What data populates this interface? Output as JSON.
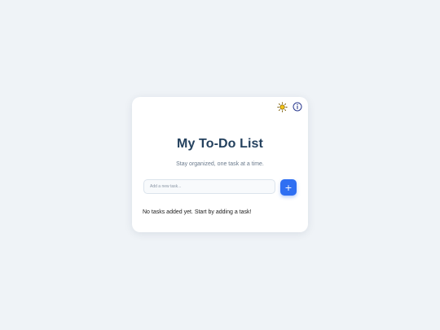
{
  "header": {
    "theme_toggle_icon": "sun-icon",
    "info_icon": "info-icon"
  },
  "main": {
    "title": "My To-Do List",
    "subtitle": "Stay organized, one task at a time.",
    "input_placeholder": "Add a new task...",
    "input_value": "",
    "add_button_symbol": "+",
    "empty_message": "No tasks added yet. Start by adding a task!"
  },
  "colors": {
    "background": "#eff3f7",
    "card": "#ffffff",
    "title": "#24415e",
    "accent": "#2f6ff2",
    "sun": "#e7b10a",
    "info": "#2b3a8f"
  }
}
